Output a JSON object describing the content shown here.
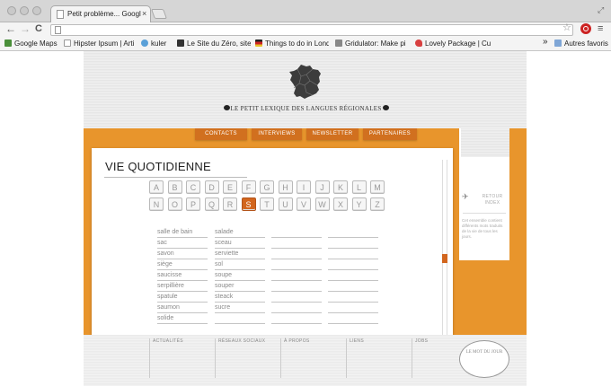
{
  "browser": {
    "tab_title": "Petit problème... Google Chr",
    "tab_close": "×",
    "nav": {
      "back": "←",
      "forward": "→",
      "reload": "C"
    },
    "star": "☆",
    "menu": "≡",
    "win_resize": "⤢"
  },
  "bookmarks": [
    {
      "label": "Google Maps",
      "icon": "maps-icon",
      "color": "#4a8f3a"
    },
    {
      "label": "Hipster Ipsum | Arti",
      "icon": "page-icon",
      "color": "#ffffff"
    },
    {
      "label": "kuler",
      "icon": "kuler-icon",
      "color": "#5aa0d8"
    },
    {
      "label": "Le Site du Zéro, site",
      "icon": "sdz-icon",
      "color": "#333333"
    },
    {
      "label": "Things to do in Lond",
      "icon": "flag-icon",
      "color": "#cc2222"
    },
    {
      "label": "Gridulator: Make pi",
      "icon": "grid-icon",
      "color": "#888888"
    },
    {
      "label": "Lovely Package | Cur",
      "icon": "heart-icon",
      "color": "#d84040"
    }
  ],
  "bookmarks_overflow": "»",
  "bookmarks_folder": "Autres favoris",
  "site": {
    "tagline": "LE PETIT LEXIQUE DES LANGUES RÉGIONALES",
    "nav": [
      "CONTACTS",
      "INTERVIEWS",
      "NEWSLETTER",
      "PARTENAIRES"
    ],
    "page_title": "VIE QUOTIDIENNE",
    "alphabet": [
      "A",
      "B",
      "C",
      "D",
      "E",
      "F",
      "G",
      "H",
      "I",
      "J",
      "K",
      "L",
      "M",
      "N",
      "O",
      "P",
      "Q",
      "R",
      "S",
      "T",
      "U",
      "V",
      "W",
      "X",
      "Y",
      "Z"
    ],
    "active_letter": "S",
    "words_col1": [
      "salle de bain",
      "sac",
      "savon",
      "siège",
      "saucisse",
      "serpillière",
      "spatule",
      "saumon",
      "solide"
    ],
    "words_col2": [
      "salade",
      "sceau",
      "serviette",
      "sol",
      "soupe",
      "souper",
      "steack",
      "sucre"
    ],
    "side": {
      "retour": "RETOUR INDEX",
      "text": "Cet ensemble contient différents mots traduits de la vie de tous les jours."
    },
    "footer": [
      "ACTUALITÉS",
      "RÉSEAUX SOCIAUX",
      "À PROPOS",
      "LIENS",
      "JOBS"
    ],
    "mot_du_jour": "LE MOT DU JOUR"
  }
}
